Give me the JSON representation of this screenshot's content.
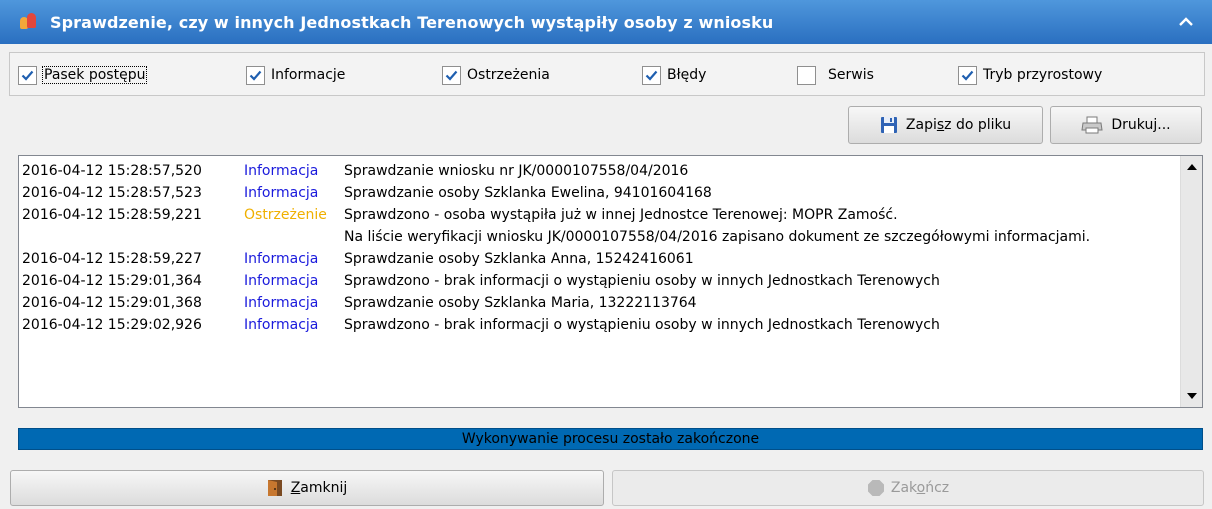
{
  "window": {
    "title": "Sprawdzenie, czy w innych Jednostkach Terenowych wystąpiły osoby z wniosku"
  },
  "options": [
    {
      "label": "Pasek postępu",
      "checked": true
    },
    {
      "label": "Informacje",
      "checked": true
    },
    {
      "label": "Ostrzeżenia",
      "checked": true
    },
    {
      "label": "Błędy",
      "checked": true
    },
    {
      "label": "Serwis",
      "checked": false
    },
    {
      "label": "Tryb przyrostowy",
      "checked": true
    }
  ],
  "toolbar": {
    "save_label_pre": "Zapi",
    "save_label_ul": "s",
    "save_label_post": "z do pliku",
    "print_label_pre": "Druku",
    "print_label_ul": "j",
    "print_label_post": "..."
  },
  "log": {
    "rows": [
      {
        "time": "2016-04-12 15:28:57,520",
        "type": "Informacja",
        "kind": "info",
        "msg": "Sprawdzanie wniosku nr JK/0000107558/04/2016"
      },
      {
        "time": "2016-04-12 15:28:57,523",
        "type": "Informacja",
        "kind": "info",
        "msg": "Sprawdzanie osoby Szklanka Ewelina, 94101604168"
      },
      {
        "time": "2016-04-12 15:28:59,221",
        "type": "Ostrzeżenie",
        "kind": "warn",
        "msg": "Sprawdzono - osoba wystąpiła już w innej Jednostce Terenowej: MOPR Zamość."
      },
      {
        "time": "",
        "type": "",
        "kind": "info",
        "msg": "Na liście weryfikacji wniosku JK/0000107558/04/2016 zapisano dokument ze szczegółowymi informacjami."
      },
      {
        "time": "2016-04-12 15:28:59,227",
        "type": "Informacja",
        "kind": "info",
        "msg": "Sprawdzanie osoby Szklanka Anna, 15242416061"
      },
      {
        "time": "2016-04-12 15:29:01,364",
        "type": "Informacja",
        "kind": "info",
        "msg": "Sprawdzono - brak informacji o wystąpieniu osoby w innych Jednostkach Terenowych"
      },
      {
        "time": "2016-04-12 15:29:01,368",
        "type": "Informacja",
        "kind": "info",
        "msg": "Sprawdzanie osoby Szklanka Maria, 13222113764"
      },
      {
        "time": "2016-04-12 15:29:02,926",
        "type": "Informacja",
        "kind": "info",
        "msg": "Sprawdzono - brak informacji o wystąpieniu osoby w innych Jednostkach Terenowych"
      }
    ]
  },
  "progress": {
    "text": "Wykonywanie procesu zostało zakończone",
    "value": 1.0
  },
  "footer": {
    "close_ul": "Z",
    "close_post": "amknij",
    "finish_pre": "Zak",
    "finish_ul": "o",
    "finish_post": "ńcz"
  },
  "colors": {
    "titlebar": "#2a6fc0",
    "info": "#1a1adc",
    "warning": "#f0b000",
    "progress": "#0069b3"
  }
}
